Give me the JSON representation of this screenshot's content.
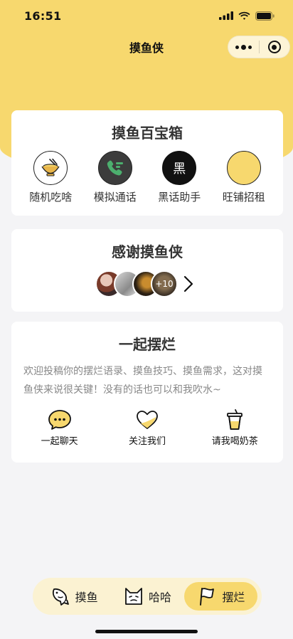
{
  "status_bar": {
    "time": "16:51"
  },
  "header": {
    "title": "摸鱼侠"
  },
  "toolbox": {
    "title": "摸鱼百宝箱",
    "items": [
      {
        "label": "随机吃啥",
        "icon": "rice-bowl-icon"
      },
      {
        "label": "模拟通话",
        "icon": "phone-call-icon"
      },
      {
        "label": "黑话助手",
        "icon": "slang-icon",
        "glyph": "黑"
      },
      {
        "label": "旺铺招租",
        "icon": "empty-circle-icon"
      }
    ]
  },
  "thanks": {
    "title": "感谢摸鱼侠",
    "more_count": "+10"
  },
  "together": {
    "title": "一起摆烂",
    "description": "欢迎投稿你的摆烂语录、摸鱼技巧、摸鱼需求，这对摸鱼侠来说很关键！没有的话也可以和我吹水~",
    "actions": [
      {
        "label": "一起聊天",
        "icon": "chat-bubble-icon"
      },
      {
        "label": "关注我们",
        "icon": "heart-icon"
      },
      {
        "label": "请我喝奶茶",
        "icon": "milk-tea-icon"
      }
    ]
  },
  "tabbar": {
    "tabs": [
      {
        "label": "摸鱼",
        "icon": "fish-icon",
        "active": false
      },
      {
        "label": "哈哈",
        "icon": "cat-face-icon",
        "active": false
      },
      {
        "label": "摆烂",
        "icon": "flag-icon",
        "active": true
      }
    ]
  },
  "colors": {
    "accent": "#f7d86e",
    "tab_bg": "#fbf2d2",
    "background": "#f4f4f6"
  }
}
